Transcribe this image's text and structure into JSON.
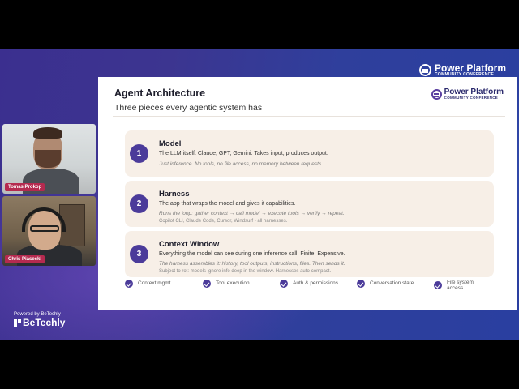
{
  "event_logo": {
    "title": "Power Platform",
    "subtitle": "COMMUNITY CONFERENCE",
    "icon": "power-platform-logo-icon"
  },
  "speakers": [
    {
      "name": "Tomas Prokop"
    },
    {
      "name": "Chris Piasecki"
    }
  ],
  "sponsor": {
    "label": "Powered by BeTechly",
    "brand": "BeTechly"
  },
  "slide": {
    "title": "Agent Architecture",
    "subtitle": "Three pieces every agentic system has",
    "logo": {
      "title": "Power Platform",
      "subtitle": "COMMUNITY CONFERENCE"
    },
    "cards": [
      {
        "number": "1",
        "title": "Model",
        "line1": "The LLM itself. Claude, GPT, Gemini. Takes input, produces output.",
        "line2": "Just inference. No tools, no file access, no memory between requests.",
        "line3": ""
      },
      {
        "number": "2",
        "title": "Harness",
        "line1": "The app that wraps the model and gives it capabilities.",
        "line2": "Runs the loop: gather context → call model → execute tools → verify → repeat.",
        "line3": "Copilot CLI, Claude Code, Cursor, Windsurf - all harnesses."
      },
      {
        "number": "3",
        "title": "Context Window",
        "line1": "Everything the model can see during one inference call. Finite. Expensive.",
        "line2": "The harness assembles it: history, tool outputs, instructions, files. Then sends it.",
        "line3": "Subject to rot: models ignore info deep in the window. Harnesses auto-compact."
      }
    ],
    "features": [
      "Context mgmt",
      "Tool execution",
      "Auth & permissions",
      "Conversation state",
      "File system access"
    ]
  },
  "colors": {
    "accent": "#4b3b9a",
    "card_bg": "#f7efe7",
    "name_tag": "#b52a4f",
    "background": "#3b3590"
  }
}
